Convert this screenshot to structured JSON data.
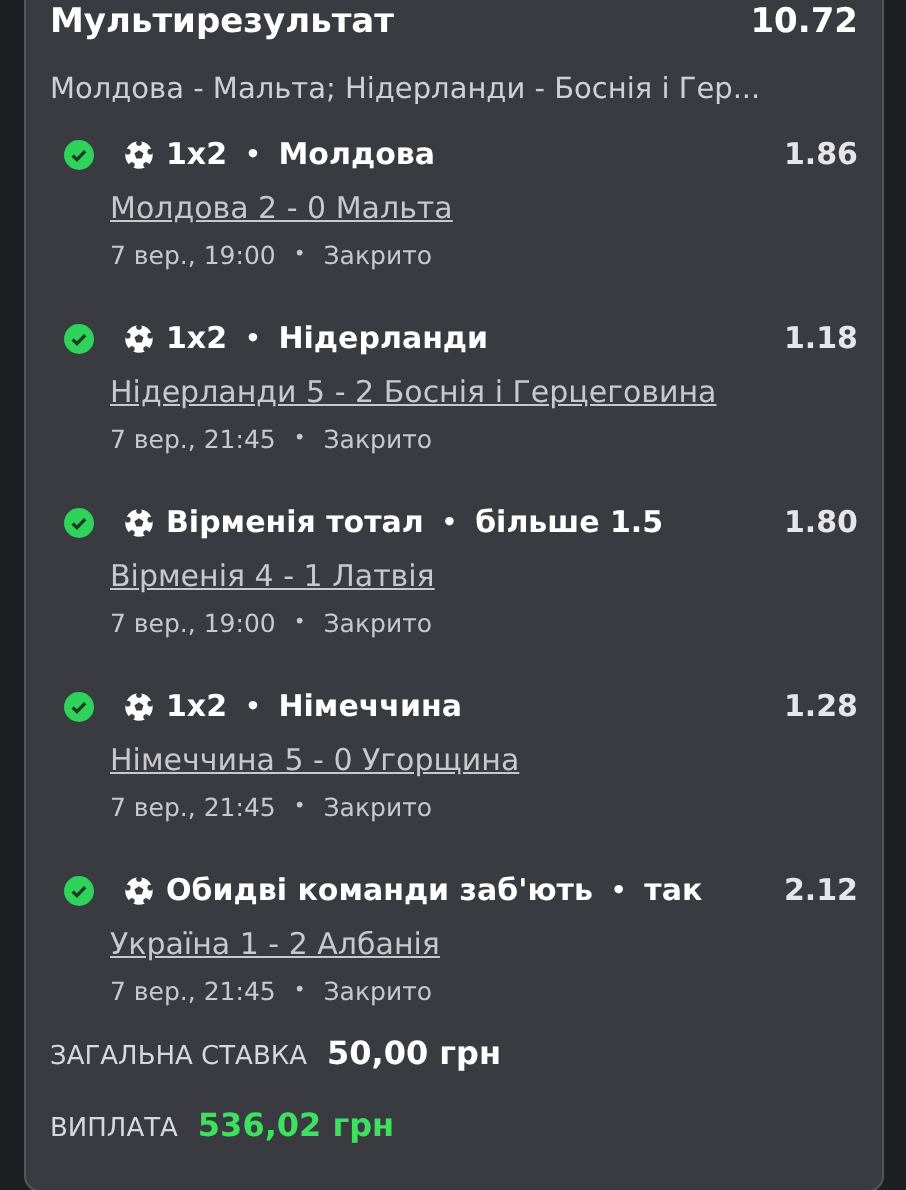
{
  "bet": {
    "title": "Мультирезультат",
    "total_odds": "10.72",
    "events_summary": "Молдова - Мальта; Нідерланди - Боснія і Гер...",
    "legs": [
      {
        "won": true,
        "market": "1x2",
        "separator": "•",
        "pick": "Молдова",
        "odds": "1.86",
        "match": "Молдова 2 - 0 Мальта",
        "time": "7 вер., 19:00",
        "dot": "•",
        "status": "Закрито"
      },
      {
        "won": true,
        "market": "1x2",
        "separator": "•",
        "pick": "Нідерланди",
        "odds": "1.18",
        "match": "Нідерланди 5 - 2 Боснія і Герцеговина",
        "time": "7 вер., 21:45",
        "dot": "•",
        "status": "Закрито"
      },
      {
        "won": true,
        "market": "Вірменія тотал",
        "separator": "•",
        "pick": "більше 1.5",
        "odds": "1.80",
        "match": "Вірменія 4 - 1 Латвія",
        "time": "7 вер., 19:00",
        "dot": "•",
        "status": "Закрито"
      },
      {
        "won": true,
        "market": "1x2",
        "separator": "•",
        "pick": "Німеччина",
        "odds": "1.28",
        "match": "Німеччина 5 - 0 Угорщина",
        "time": "7 вер., 21:45",
        "dot": "•",
        "status": "Закрито"
      },
      {
        "won": true,
        "market": "Обидві команди заб'ють",
        "separator": "•",
        "pick": "так",
        "odds": "2.12",
        "match": "Україна 1 - 2 Албанія",
        "time": "7 вер., 21:45",
        "dot": "•",
        "status": "Закрито"
      }
    ],
    "stake_label": "ЗАГАЛЬНА СТАВКА",
    "stake": "50,00 грн",
    "payout_label": "ВИПЛАТА",
    "payout": "536,02 грн"
  }
}
